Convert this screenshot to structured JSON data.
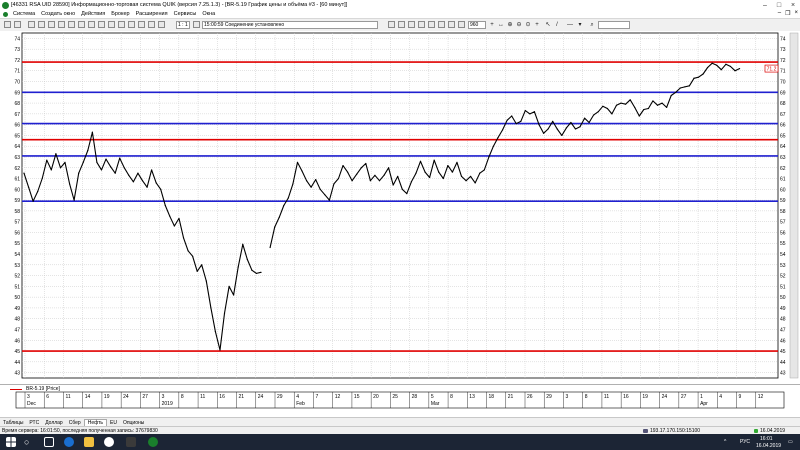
{
  "window": {
    "title": "[46331 RSA UID 28590] Информационно-торговая система QUIK (версия 7.25.1.3) - [BR-5.19 График цены и объёма #3 - [60 минут]]"
  },
  "menu": {
    "items": [
      "Система",
      "Создать окно",
      "Действия",
      "Брокер",
      "Расширения",
      "Сервисы",
      "Окна"
    ]
  },
  "toolbar": {
    "ratio_field": "1 : 1",
    "status_field": "15:00:59 Соединение установлено",
    "instrument_field": "960"
  },
  "chart_data": {
    "type": "line",
    "title": "",
    "instrument": "BR-5.19 [Price]",
    "ylim": [
      42.5,
      74.5
    ],
    "y_ticks": [
      43,
      44,
      45,
      46,
      47,
      48,
      49,
      50,
      51,
      52,
      53,
      54,
      55,
      56,
      57,
      58,
      59,
      60,
      61,
      62,
      63,
      64,
      65,
      66,
      67,
      68,
      69,
      70,
      71,
      72,
      73,
      74
    ],
    "x_tick_labels": [
      "3",
      "6",
      "11",
      "14",
      "19",
      "24",
      "27",
      "3",
      "8",
      "11",
      "16",
      "21",
      "24",
      "29",
      "4",
      "7",
      "12",
      "15",
      "20",
      "25",
      "28",
      "5",
      "8",
      "13",
      "18",
      "21",
      "26",
      "29",
      "3",
      "8",
      "11",
      "16",
      "19",
      "24",
      "27",
      "1",
      "4",
      "9",
      "12"
    ],
    "x_month_labels": [
      "Dec",
      "2019",
      "Feb",
      "Mar",
      "Apr"
    ],
    "last_price_label": "71.2",
    "horizontal_levels": [
      {
        "value": 71.8,
        "color": "#e00000"
      },
      {
        "value": 69.0,
        "color": "#2020d0"
      },
      {
        "value": 66.1,
        "color": "#2020d0"
      },
      {
        "value": 64.6,
        "color": "#e00000"
      },
      {
        "value": 63.1,
        "color": "#2020d0"
      },
      {
        "value": 58.9,
        "color": "#2020d0"
      },
      {
        "value": 45.0,
        "color": "#e00000"
      }
    ],
    "series": [
      {
        "values": [
          [
            0,
            61.5
          ],
          [
            1,
            60.2
          ],
          [
            2,
            58.9
          ],
          [
            3,
            59.8
          ],
          [
            4,
            61.0
          ],
          [
            5,
            62.7
          ],
          [
            6,
            61.8
          ],
          [
            7,
            63.3
          ],
          [
            8,
            62.0
          ],
          [
            9,
            62.5
          ],
          [
            10,
            60.5
          ],
          [
            11,
            59.0
          ],
          [
            12,
            61.5
          ],
          [
            13,
            62.5
          ],
          [
            14,
            63.6
          ],
          [
            15,
            65.3
          ],
          [
            16,
            62.5
          ],
          [
            17,
            61.8
          ],
          [
            18,
            62.8
          ],
          [
            19,
            62.1
          ],
          [
            20,
            61.5
          ],
          [
            21,
            62.9
          ],
          [
            22,
            62.0
          ],
          [
            23,
            61.3
          ],
          [
            24,
            60.7
          ],
          [
            25,
            61.5
          ],
          [
            26,
            60.8
          ],
          [
            27,
            60.2
          ],
          [
            28,
            61.8
          ],
          [
            29,
            60.6
          ],
          [
            30,
            60.0
          ],
          [
            31,
            58.5
          ],
          [
            32,
            57.5
          ],
          [
            33,
            56.6
          ],
          [
            34,
            57.3
          ],
          [
            35,
            55.5
          ],
          [
            36,
            54.3
          ],
          [
            37,
            53.8
          ],
          [
            38,
            52.4
          ],
          [
            39,
            53.0
          ],
          [
            40,
            51.5
          ],
          [
            41,
            49.0
          ],
          [
            42,
            46.8
          ],
          [
            43,
            45.1
          ],
          [
            44,
            48.5
          ],
          [
            45,
            51.0
          ],
          [
            46,
            50.2
          ],
          [
            47,
            52.8
          ],
          [
            48,
            54.9
          ],
          [
            49,
            53.5
          ],
          [
            50,
            52.5
          ],
          [
            51,
            52.2
          ],
          [
            52,
            52.3
          ],
          [
            53,
            null
          ],
          [
            54,
            54.6
          ],
          [
            55,
            56.5
          ],
          [
            56,
            57.4
          ],
          [
            57,
            58.5
          ],
          [
            58,
            59.2
          ],
          [
            59,
            60.5
          ],
          [
            60,
            62.5
          ],
          [
            61,
            61.7
          ],
          [
            62,
            60.8
          ],
          [
            63,
            60.2
          ],
          [
            64,
            60.9
          ],
          [
            65,
            60.0
          ],
          [
            66,
            59.5
          ],
          [
            67,
            59.0
          ],
          [
            68,
            60.5
          ],
          [
            69,
            61.0
          ],
          [
            70,
            62.2
          ],
          [
            71,
            61.6
          ],
          [
            72,
            60.8
          ],
          [
            73,
            61.4
          ],
          [
            74,
            62.0
          ],
          [
            75,
            62.4
          ],
          [
            76,
            60.8
          ],
          [
            77,
            61.3
          ],
          [
            78,
            60.8
          ],
          [
            79,
            61.3
          ],
          [
            80,
            62.0
          ],
          [
            81,
            60.4
          ],
          [
            82,
            61.2
          ],
          [
            83,
            60.0
          ],
          [
            84,
            59.6
          ],
          [
            85,
            60.7
          ],
          [
            86,
            61.5
          ],
          [
            87,
            62.6
          ],
          [
            88,
            61.6
          ],
          [
            89,
            61.1
          ],
          [
            90,
            62.7
          ],
          [
            91,
            61.6
          ],
          [
            92,
            61.0
          ],
          [
            93,
            62.2
          ],
          [
            94,
            61.6
          ],
          [
            95,
            62.5
          ],
          [
            96,
            61.2
          ],
          [
            97,
            60.8
          ],
          [
            98,
            61.2
          ],
          [
            99,
            60.6
          ],
          [
            100,
            61.5
          ],
          [
            101,
            61.8
          ],
          [
            102,
            63.0
          ],
          [
            103,
            64.0
          ],
          [
            104,
            64.8
          ],
          [
            105,
            65.5
          ],
          [
            106,
            66.4
          ],
          [
            107,
            66.8
          ],
          [
            108,
            66.1
          ],
          [
            109,
            66.3
          ],
          [
            110,
            67.3
          ],
          [
            111,
            67.0
          ],
          [
            112,
            67.2
          ],
          [
            113,
            66.0
          ],
          [
            114,
            65.2
          ],
          [
            115,
            65.6
          ],
          [
            116,
            66.3
          ],
          [
            117,
            65.6
          ],
          [
            118,
            65.0
          ],
          [
            119,
            65.7
          ],
          [
            120,
            66.2
          ],
          [
            121,
            65.6
          ],
          [
            122,
            65.8
          ],
          [
            123,
            66.6
          ],
          [
            124,
            66.2
          ],
          [
            125,
            66.9
          ],
          [
            126,
            67.2
          ],
          [
            127,
            67.7
          ],
          [
            128,
            67.5
          ],
          [
            129,
            67.0
          ],
          [
            130,
            67.8
          ],
          [
            131,
            68.0
          ],
          [
            132,
            67.9
          ],
          [
            133,
            68.3
          ],
          [
            134,
            67.6
          ],
          [
            135,
            66.8
          ],
          [
            136,
            67.4
          ],
          [
            137,
            67.5
          ],
          [
            138,
            68.2
          ],
          [
            139,
            67.8
          ],
          [
            140,
            68.0
          ],
          [
            141,
            67.6
          ],
          [
            142,
            68.7
          ],
          [
            143,
            69.0
          ],
          [
            144,
            69.4
          ],
          [
            145,
            69.5
          ],
          [
            146,
            69.6
          ],
          [
            147,
            70.3
          ],
          [
            148,
            70.4
          ],
          [
            149,
            70.7
          ],
          [
            150,
            71.3
          ],
          [
            151,
            71.7
          ],
          [
            152,
            71.5
          ],
          [
            153,
            71.1
          ],
          [
            154,
            71.6
          ],
          [
            155,
            71.4
          ],
          [
            156,
            71.0
          ],
          [
            157,
            71.2
          ]
        ]
      }
    ]
  },
  "tabs": {
    "items": [
      "Таблицы",
      "РТС",
      "Доллар",
      "Сбер",
      "Нефть",
      "EU",
      "Опционы"
    ]
  },
  "status": {
    "server_time": "Время сервера: 16:01:50, последняя полученная запись: 37679830",
    "connection": "193.17.170.150:15100",
    "date": "16.04.2019"
  },
  "taskbar": {
    "language": "РУС",
    "time": "16:01",
    "date": "16.04.2019"
  }
}
